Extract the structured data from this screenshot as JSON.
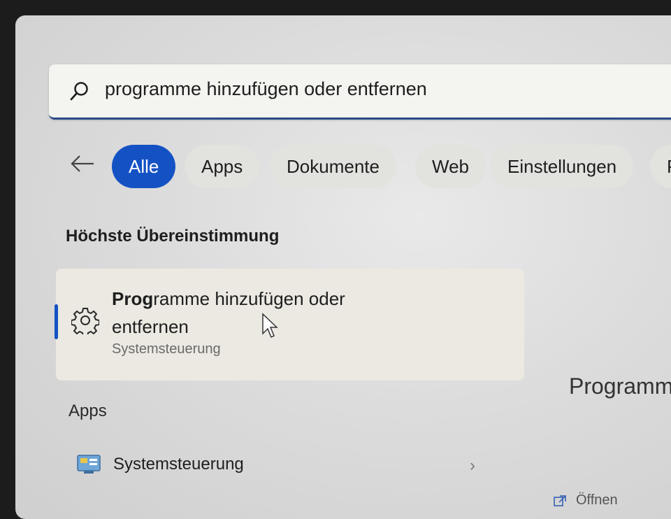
{
  "search": {
    "query": "programme hinzufügen oder entfernen"
  },
  "filters": {
    "items": [
      {
        "label": "Alle",
        "active": true
      },
      {
        "label": "Apps",
        "active": false
      },
      {
        "label": "Dokumente",
        "active": false
      },
      {
        "label": "Web",
        "active": false
      },
      {
        "label": "Einstellungen",
        "active": false
      },
      {
        "label": "P",
        "active": false
      }
    ]
  },
  "best_match": {
    "section_title": "Höchste Übereinstimmung",
    "title_bold": "Prog",
    "title_rest": "ramme hinzufügen oder entfernen",
    "subtitle": "Systemsteuerung",
    "icon": "gear-icon"
  },
  "apps": {
    "section_title": "Apps",
    "items": [
      {
        "label": "Systemsteuerung",
        "icon": "control-panel-icon"
      }
    ]
  },
  "preview": {
    "title": "Programm",
    "open_label": "Öffnen"
  },
  "colors": {
    "accent": "#1452c4",
    "search_underline": "#2a4a86"
  }
}
